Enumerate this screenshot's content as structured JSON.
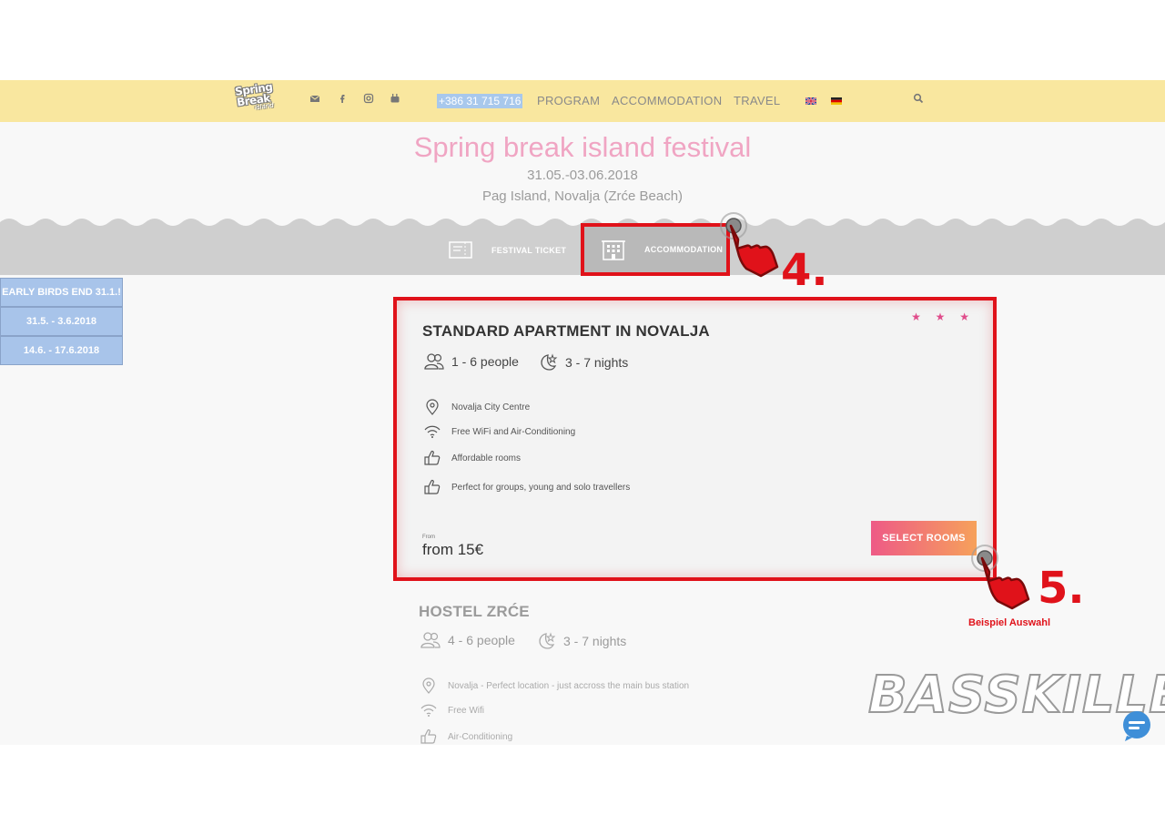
{
  "header": {
    "logo": {
      "line1": "Spring",
      "line2": "Break",
      "line3": "island"
    },
    "social_icons": [
      "mail-icon",
      "facebook-icon",
      "instagram-icon",
      "youtube-icon"
    ],
    "phone": "+386 31 715 716",
    "nav": [
      "PROGRAM",
      "ACCOMMODATION",
      "TRAVEL"
    ],
    "languages": [
      "en-flag-icon",
      "de-flag-icon"
    ],
    "search_icon": "search-icon",
    "colors": {
      "bar": "#f9e79f",
      "phone_bg": "#a8c8ec"
    }
  },
  "hero": {
    "title": "Spring break island festival",
    "date": "31.05.-03.06.2018",
    "location": "Pag Island, Novalja (Zrće Beach)",
    "title_color": "#f0a5c3"
  },
  "tabs": [
    {
      "label": "FESTIVAL TICKET",
      "icon": "ticket-icon",
      "active": false
    },
    {
      "label": "ACCOMMODATION",
      "icon": "building-icon",
      "active": true
    }
  ],
  "sidebar": {
    "items": [
      "EARLY BIRDS END 31.1.!",
      "31.5.  -   3.6.2018",
      "14.6. - 17.6.2018"
    ],
    "color": "#a8c4ea"
  },
  "listings": [
    {
      "title": "STANDARD APARTMENT IN NOVALJA",
      "stars": "★ ★ ★",
      "people": "1 - 6 people",
      "nights": "3 - 7 nights",
      "features": [
        {
          "icon": "location-pin-icon",
          "text": "Novalja City Centre"
        },
        {
          "icon": "wifi-icon",
          "text": "Free WiFi and Air-Conditioning"
        },
        {
          "icon": "thumbs-up-icon",
          "text": "Affordable rooms"
        },
        {
          "icon": "thumbs-up-icon",
          "text": "Perfect for groups, young and solo travellers"
        }
      ],
      "from_label": "From",
      "price": "from 15€",
      "button": "SELECT ROOMS"
    },
    {
      "title": "HOSTEL ZRĆE",
      "people": "4 - 6 people",
      "nights": "3 - 7 nights",
      "features": [
        {
          "icon": "location-pin-icon",
          "text": "Novalja - Perfect location - just accross the main bus station"
        },
        {
          "icon": "wifi-icon",
          "text": "Free Wifi"
        },
        {
          "icon": "thumbs-up-icon",
          "text": "Air-Conditioning"
        }
      ]
    }
  ],
  "annotations": {
    "step4": "4.",
    "step5": "5.",
    "caption": "Beispiel Auswahl",
    "color": "#e0121a"
  },
  "watermark": "BASSKILLER"
}
